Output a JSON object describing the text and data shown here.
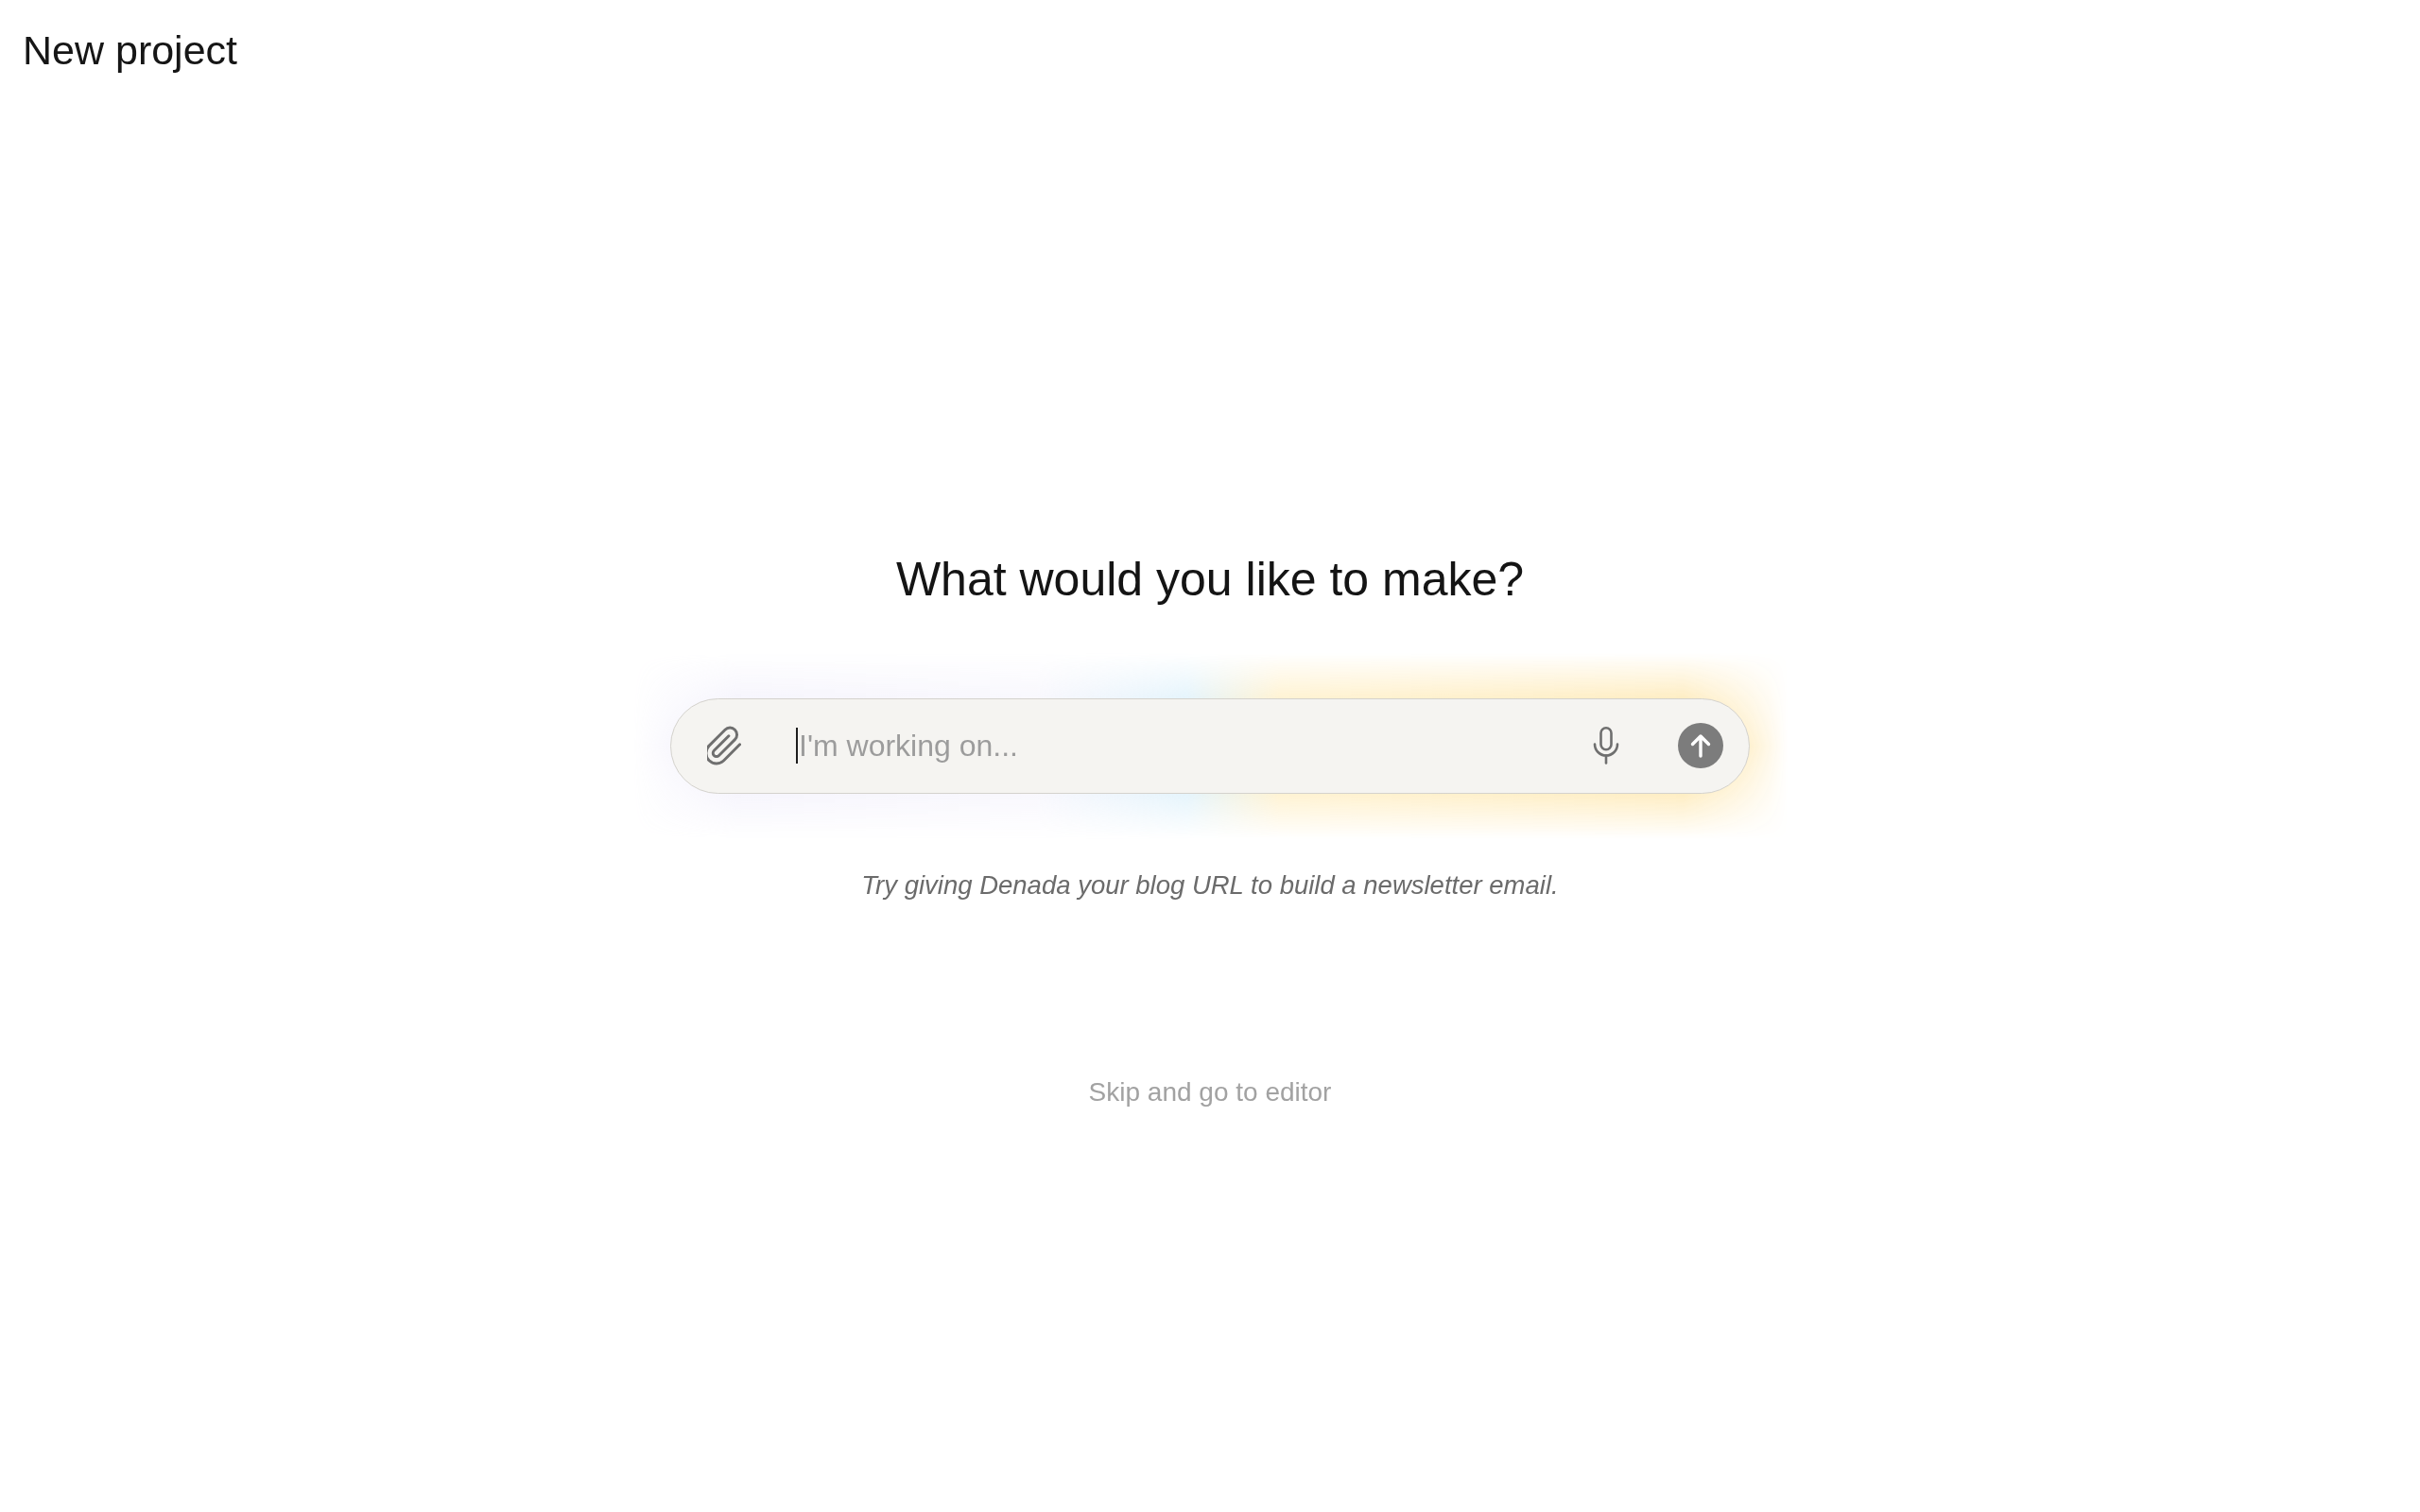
{
  "header": {
    "title": "New project"
  },
  "prompt": {
    "heading": "What would you like to make?",
    "input": {
      "placeholder": "I'm working on...",
      "focused": true
    }
  },
  "hint": "Try giving Denada your blog URL to build a newsletter email.",
  "skip_link": "Skip and go to editor"
}
